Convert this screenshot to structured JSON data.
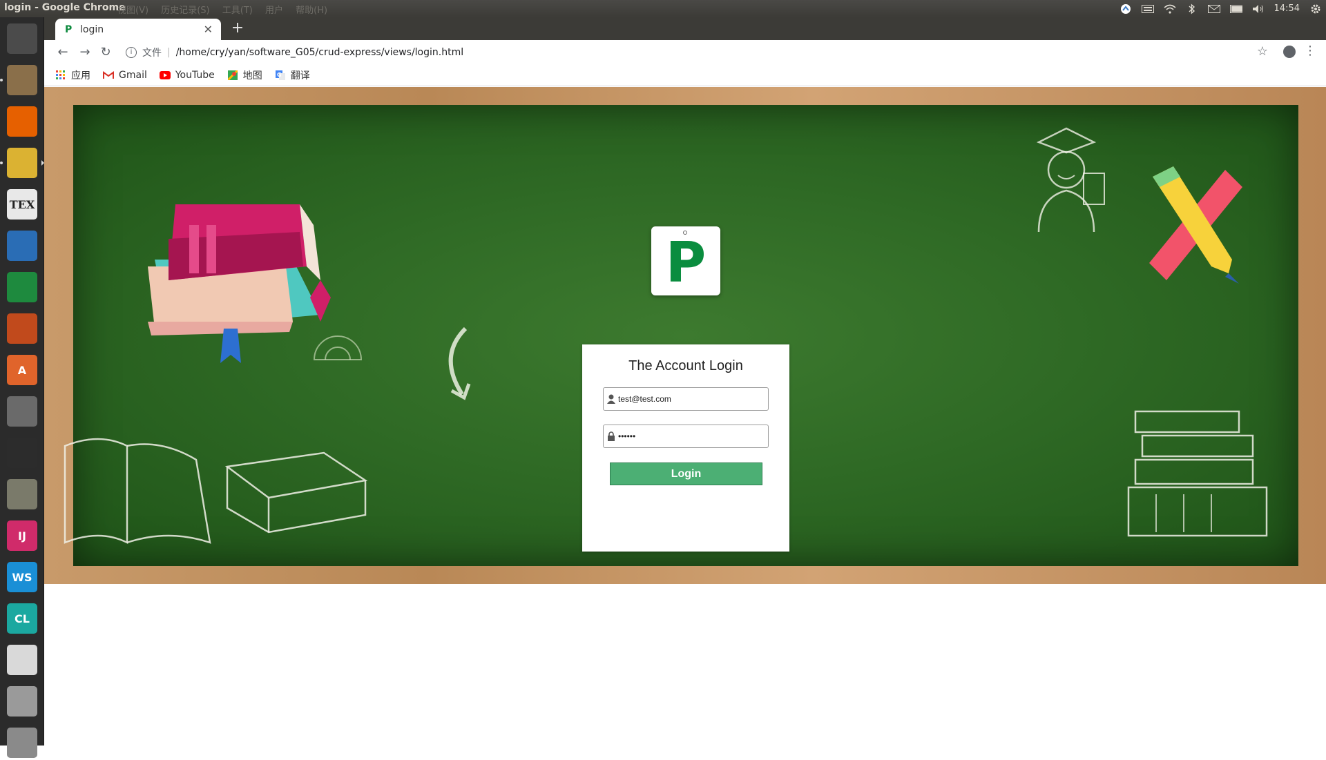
{
  "system": {
    "window_title": "login - Google Chrome",
    "ghost_menu": [
      "视图(V)",
      "历史记录(S)",
      "工具(T)",
      "用户",
      "帮助(H)"
    ],
    "clock": "14:54"
  },
  "launcher": {
    "items": [
      {
        "name": "ubuntu-dash-icon",
        "color": "#4b4b4b"
      },
      {
        "name": "file-manager-icon",
        "color": "#8a6f4a"
      },
      {
        "name": "firefox-icon",
        "color": "#e66000"
      },
      {
        "name": "chrome-icon",
        "color": "#dbb232"
      },
      {
        "name": "texmaker-icon",
        "color": "#e8e8e8",
        "label": "TEX"
      },
      {
        "name": "writer-icon",
        "color": "#2a6db5"
      },
      {
        "name": "calc-icon",
        "color": "#1e8a3e"
      },
      {
        "name": "impress-icon",
        "color": "#c14a1c"
      },
      {
        "name": "software-center-icon",
        "color": "#e0642b",
        "label": "A"
      },
      {
        "name": "system-settings-icon",
        "color": "#6a6a6a"
      },
      {
        "name": "terminal-icon",
        "color": "#2c2c2c"
      },
      {
        "name": "gimp-icon",
        "color": "#7a7a6a"
      },
      {
        "name": "intellij-icon",
        "color": "#d02b6a",
        "label": "IJ"
      },
      {
        "name": "webstorm-icon",
        "color": "#1a8fd6",
        "label": "WS"
      },
      {
        "name": "clion-icon",
        "color": "#1ba8a0",
        "label": "CL"
      },
      {
        "name": "document-viewer-icon",
        "color": "#d9d9d9"
      },
      {
        "name": "drive-icon",
        "color": "#9a9a9a"
      },
      {
        "name": "trash-icon",
        "color": "#8a8a8a"
      }
    ]
  },
  "browser": {
    "tab_title": "login",
    "tab_favicon": "P",
    "address_scheme": "文件",
    "address_url": "/home/cry/yan/software_G05/crud-express/views/login.html",
    "bookmarks": [
      {
        "label": "应用",
        "icon": "apps-grid-icon"
      },
      {
        "label": "Gmail",
        "icon": "gmail-icon"
      },
      {
        "label": "YouTube",
        "icon": "youtube-icon"
      },
      {
        "label": "地图",
        "icon": "maps-icon"
      },
      {
        "label": "翻译",
        "icon": "translate-icon"
      }
    ]
  },
  "login": {
    "logo_letter": "P",
    "heading": "The Account Login",
    "email_value": "test@test.com",
    "password_value": "••••••",
    "button_label": "Login"
  },
  "colors": {
    "chalkboard": "#2f6a25",
    "frame": "#c89a6a",
    "button": "#4caf74",
    "logo": "#0a8d3f"
  }
}
